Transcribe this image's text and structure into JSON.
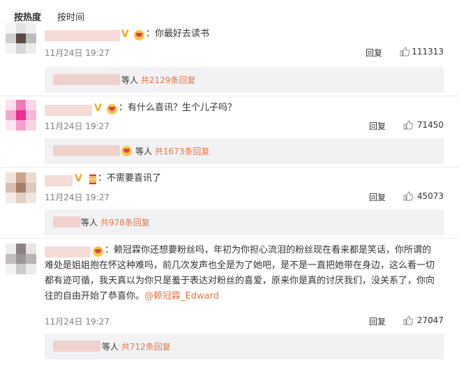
{
  "tabs": {
    "hot": "按热度",
    "time": "按时间"
  },
  "comments": [
    {
      "text": "：你最好去读书",
      "time": "11月24日 19:27",
      "reply": "回复",
      "likes": "111313",
      "sub_suffix": "等人",
      "sub_count": "共2129条回复"
    },
    {
      "text": "：有什么喜讯？生个儿子吗？",
      "time": "11月24日 19:27",
      "reply": "回复",
      "likes": "71450",
      "sub_suffix": "等人",
      "sub_count": "共1673条回复"
    },
    {
      "text": "：不需要喜讯了",
      "time": "11月24日 19:27",
      "reply": "回复",
      "likes": "45073",
      "sub_suffix": "等人",
      "sub_count": "共978条回复"
    },
    {
      "line1": "：赖冠霖你还想要粉丝吗，年初为你担心流泪的粉丝现在看来都是笑话，你所谓的",
      "line2": "难处是姐姐抱在怀这种难吗，前几次发声也全是为了她吧，是不是一直把她带在身边，这么看一切",
      "line3": "都有迹可循，我天真以为你只是羞于表达对粉丝的喜爱，原来你是真的讨厌我们，没关系了，你向",
      "line4": "往的自由开始了恭喜你。",
      "mention": "@赖冠霖_Edward",
      "time": "11月24日 19:27",
      "reply": "回复",
      "likes": "27047",
      "sub_suffix": "等人",
      "sub_count": "共712条回复"
    }
  ],
  "badges": {
    "verified": "V"
  },
  "colors": {
    "accent": "#eb7340",
    "muted": "#808080",
    "sub_bg": "#f2f2f5"
  }
}
